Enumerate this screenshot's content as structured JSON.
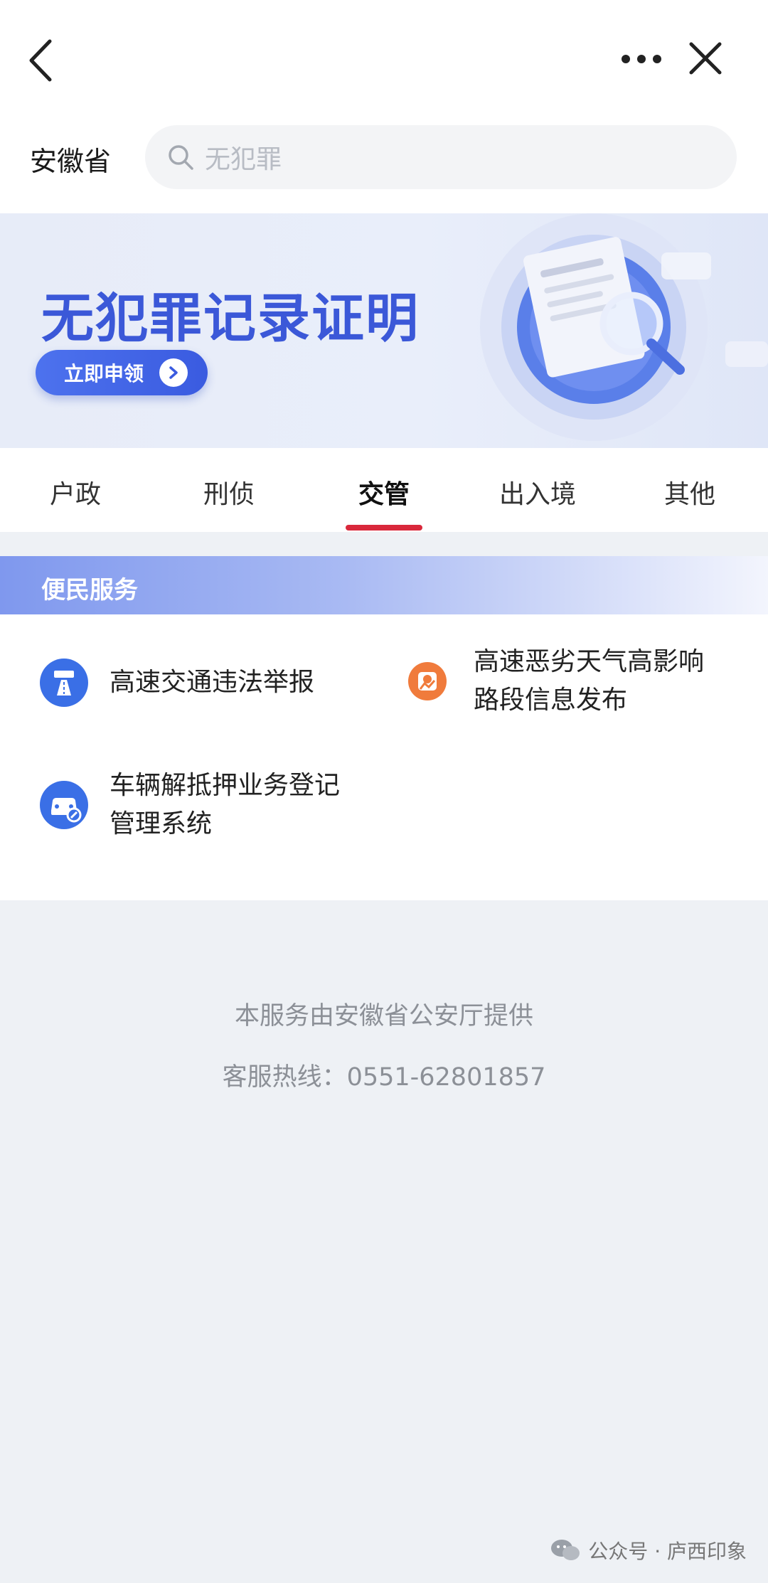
{
  "header": {
    "province": "安徽省",
    "search_placeholder": "无犯罪"
  },
  "banner": {
    "title": "无犯罪记录证明",
    "button_label": "立即申领"
  },
  "tabs": [
    {
      "label": "户政",
      "active": false
    },
    {
      "label": "刑侦",
      "active": false
    },
    {
      "label": "交管",
      "active": true
    },
    {
      "label": "出入境",
      "active": false
    },
    {
      "label": "其他",
      "active": false
    }
  ],
  "section": {
    "title": "便民服务",
    "items": [
      {
        "line1": "高速交通违法举报",
        "line2": "",
        "icon": "highway-violation-icon",
        "color": "#3a6fe6"
      },
      {
        "line1": "高速恶劣天气高影响",
        "line2": "路段信息发布",
        "icon": "weather-road-icon",
        "color": "#f07b3c"
      },
      {
        "line1": "车辆解抵押业务登记",
        "line2": "管理系统",
        "icon": "vehicle-mortgage-icon",
        "color": "#3a6fe6"
      }
    ]
  },
  "footer": {
    "provider": "本服务由安徽省公安厅提供",
    "hotline": "客服热线：0551-62801857"
  },
  "watermark": {
    "text": "公众号 · 庐西印象"
  },
  "colors": {
    "accent_red": "#d9283b",
    "brand_blue": "#3b58d8"
  }
}
